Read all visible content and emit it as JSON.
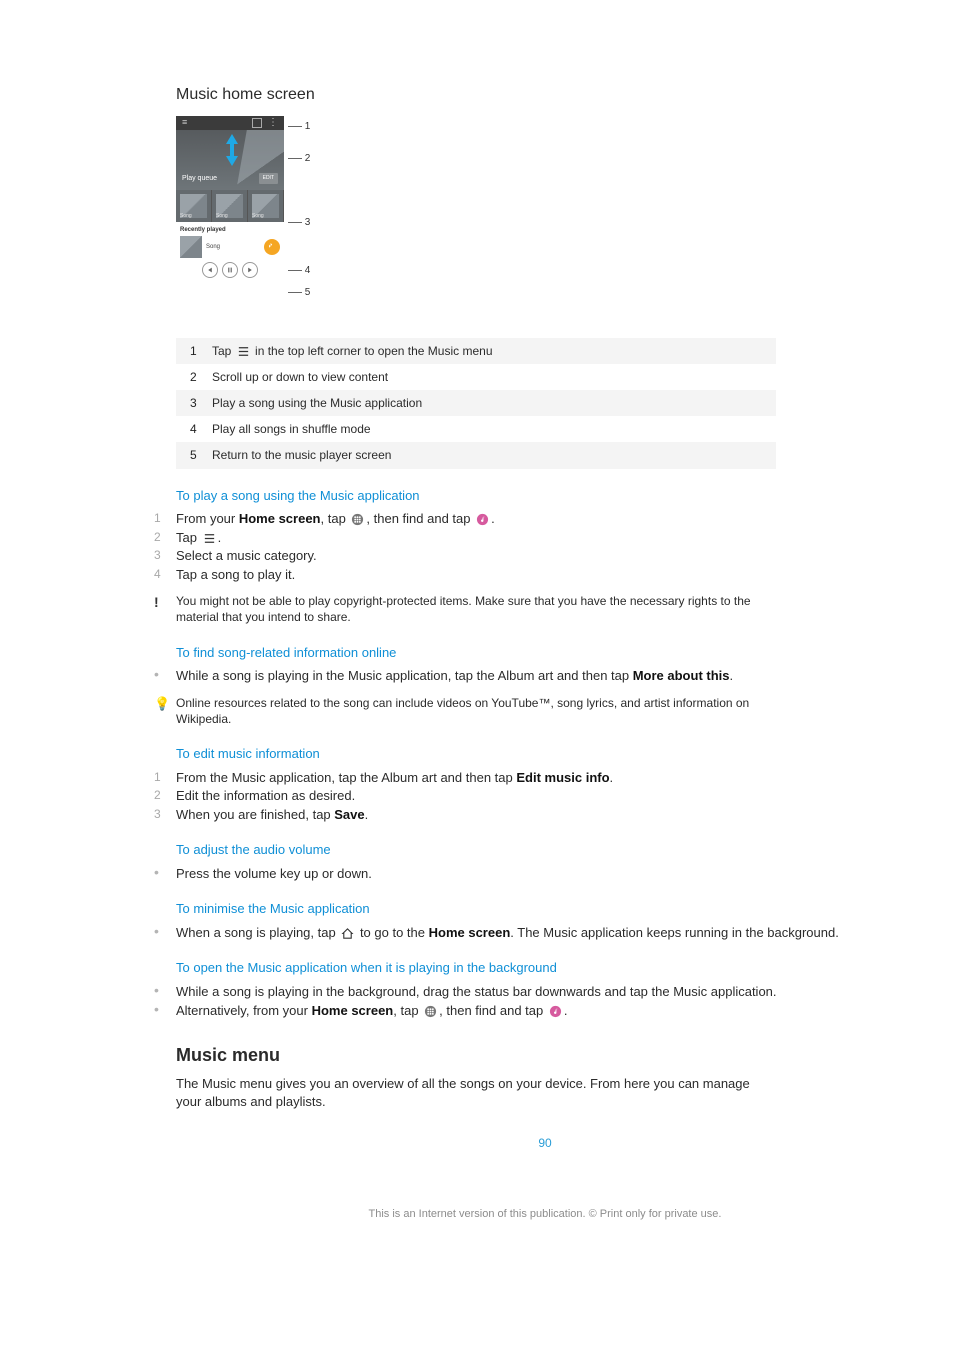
{
  "title": "Music home screen",
  "mock": {
    "play_queue": "Play queue",
    "edit": "EDIT",
    "recently": "Recently played",
    "song_label": "Song",
    "song_small": "Song"
  },
  "callouts": {
    "c1": "1",
    "c2": "2",
    "c3": "3",
    "c4": "4",
    "c5": "5"
  },
  "legend": [
    {
      "n": "1",
      "pre": "Tap ",
      "post": " in the top left corner to open the Music menu",
      "icon": "menu"
    },
    {
      "n": "2",
      "t": "Scroll up or down to view content"
    },
    {
      "n": "3",
      "t": "Play a song using the Music application"
    },
    {
      "n": "4",
      "t": "Play all songs in shuffle mode"
    },
    {
      "n": "5",
      "t": "Return to the music player screen"
    }
  ],
  "sec1": {
    "head": "To play a song using the Music application",
    "steps": [
      {
        "n": "1",
        "parts": [
          "From your ",
          {
            "b": "Home screen"
          },
          ", tap ",
          {
            "icon": "apps"
          },
          ", then find and tap ",
          {
            "icon": "music"
          },
          "."
        ]
      },
      {
        "n": "2",
        "parts": [
          "Tap ",
          {
            "icon": "menu"
          },
          "."
        ]
      },
      {
        "n": "3",
        "parts": [
          "Select a music category."
        ]
      },
      {
        "n": "4",
        "parts": [
          "Tap a song to play it."
        ]
      }
    ],
    "warn": "You might not be able to play copyright-protected items. Make sure that you have the necessary rights to the material that you intend to share."
  },
  "sec2": {
    "head": "To find song-related information online",
    "bullet": {
      "parts": [
        "While a song is playing in the Music application, tap the Album art and then tap ",
        {
          "b": "More about this"
        },
        "."
      ]
    },
    "tip": "Online resources related to the song can include videos on YouTube™, song lyrics, and artist information on Wikipedia."
  },
  "sec3": {
    "head": "To edit music information",
    "steps": [
      {
        "n": "1",
        "parts": [
          "From the Music application, tap the Album art and then tap ",
          {
            "b": "Edit music info"
          },
          "."
        ]
      },
      {
        "n": "2",
        "parts": [
          "Edit the information as desired."
        ]
      },
      {
        "n": "3",
        "parts": [
          "When you are finished, tap ",
          {
            "b": "Save"
          },
          "."
        ]
      }
    ]
  },
  "sec4": {
    "head": "To adjust the audio volume",
    "bullet": {
      "parts": [
        "Press the volume key up or down."
      ]
    }
  },
  "sec5": {
    "head": "To minimise the Music application",
    "bullet": {
      "parts": [
        "When a song is playing, tap ",
        {
          "icon": "home"
        },
        " to go to the ",
        {
          "b": "Home screen"
        },
        ". The Music application keeps running in the background."
      ]
    }
  },
  "sec6": {
    "head": "To open the Music application when it is playing in the background",
    "bullets": [
      {
        "parts": [
          "While a song is playing in the background, drag the status bar downwards and tap the Music application."
        ]
      },
      {
        "parts": [
          "Alternatively, from your ",
          {
            "b": "Home screen"
          },
          ", tap ",
          {
            "icon": "apps"
          },
          ", then find and tap ",
          {
            "icon": "music"
          },
          "."
        ]
      }
    ]
  },
  "menu_head": "Music menu",
  "menu_para": "The Music menu gives you an overview of all the songs on your device. From here you can manage your albums and playlists.",
  "page_number": "90",
  "footnote": "This is an Internet version of this publication. © Print only for private use."
}
